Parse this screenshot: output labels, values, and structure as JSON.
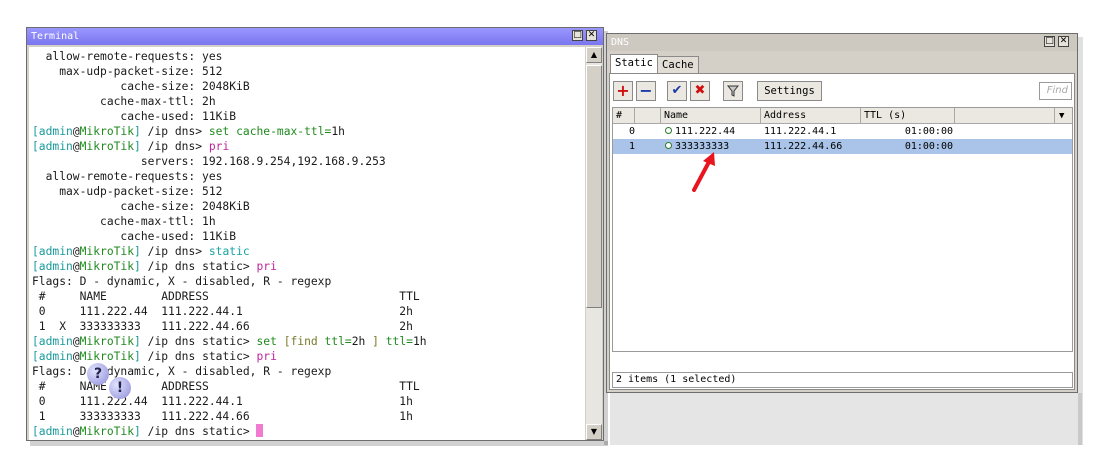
{
  "terminal": {
    "title": "Terminal",
    "prompt_admin": "[admin",
    "prompt_at": "@",
    "prompt_host": "MikroTik",
    "prompt_close": "]",
    "lines": {
      "l1": "  allow-remote-requests: yes",
      "l2": "    max-udp-packet-size: 512",
      "l3": "             cache-size: 2048KiB",
      "l4": "          cache-max-ttl: 2h",
      "l5": "             cache-used: 11KiB",
      "l6_path": " /ip dns> ",
      "l6_cmd": "set ",
      "l6_arg": "cache-max-ttl=",
      "l6_val": "1h",
      "l7_path": " /ip dns> ",
      "l7_cmd": "pri",
      "l8": "                servers: 192.168.9.254,192.168.9.253",
      "l9": "  allow-remote-requests: yes",
      "l10": "    max-udp-packet-size: 512",
      "l11": "             cache-size: 2048KiB",
      "l12": "          cache-max-ttl: 1h",
      "l13": "             cache-used: 11KiB",
      "l14_path": " /ip dns> ",
      "l14_cmd": "static",
      "l15_path": " /ip dns static> ",
      "l15_cmd": "pri",
      "l16": "Flags: D - dynamic, X - disabled, R - regexp",
      "l17": " #     NAME        ADDRESS                            TTL",
      "l18": " 0     111.222.44  111.222.44.1                       2h",
      "l19": " 1  X  333333333   111.222.44.66                      2h",
      "l20_path": " /ip dns static> ",
      "l20_set": "set ",
      "l20_find": "[find ",
      "l20_ttl": "ttl=",
      "l20_v1": "2h ",
      "l20_close": "] ",
      "l20_ttl2": "ttl=",
      "l20_v2": "1h",
      "l21_path": " /ip dns static> ",
      "l21_cmd": "pri",
      "l22": "Flags: D - dynamic, X - disabled, R - regexp",
      "l23": " #     NAME        ADDRESS                            TTL",
      "l24": " 0     111.222.44  111.222.44.1                       1h",
      "l25": " 1     333333333   111.222.44.66                      1h",
      "l26_path": " /ip dns static> "
    },
    "scroll_up": "▲",
    "scroll_down": "▼"
  },
  "dns": {
    "title": "DNS",
    "tabs": [
      "Static",
      "Cache"
    ],
    "settings_label": "Settings",
    "find_placeholder": "Find",
    "columns": [
      "#",
      "Name",
      "Address",
      "TTL (s)"
    ],
    "rows": [
      {
        "num": "0",
        "name": "111.222.44",
        "address": "111.222.44.1",
        "ttl": "01:00:00"
      },
      {
        "num": "1",
        "name": "333333333",
        "address": "111.222.44.66",
        "ttl": "01:00:00"
      }
    ],
    "status": "2 items (1 selected)"
  },
  "colors": {
    "selected_row": "#a9c4e8",
    "titlebar": "#8a86f5",
    "annotation_arrow": "#e8141e"
  }
}
